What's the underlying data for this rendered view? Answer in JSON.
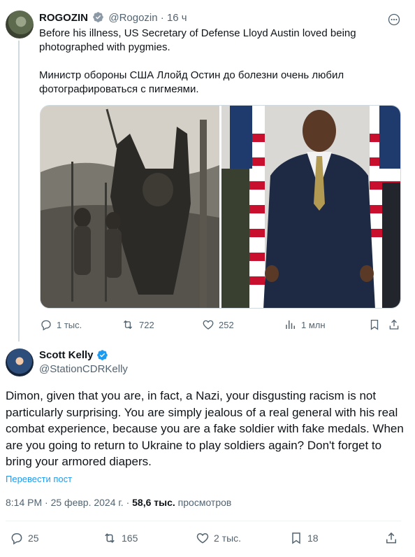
{
  "parent_tweet": {
    "author_name": "ROGOZIN",
    "author_handle": "@Rogozin",
    "separator": "·",
    "time": "16 ч",
    "text": "Before his illness, US Secretary of Defense Lloyd Austin loved being photographed with pygmies.\n\nМинистр обороны США Ллойд Остин до болезни очень любил фотографироваться с пигмеями.",
    "actions": {
      "replies": "1 тыс.",
      "reposts": "722",
      "likes": "252",
      "views": "1 млн"
    }
  },
  "reply_tweet": {
    "author_name": "Scott Kelly",
    "author_handle": "@StationCDRKelly",
    "text": "Dimon, given that you are, in fact, a Nazi, your disgusting racism is not particularly surprising. You are simply jealous of a real general with his real combat experience, because you are a fake soldier with fake medals. When are you going to return to Ukraine to play soldiers again? Don't forget to bring your armored diapers.",
    "translate_label": "Перевести пост",
    "time": "8:14 PM",
    "separator": "·",
    "date": "25 февр. 2024 г.",
    "views_count": "58,6 тыс.",
    "views_label": "просмотров",
    "actions": {
      "replies": "25",
      "reposts": "165",
      "likes": "2 тыс.",
      "bookmarks": "18"
    }
  },
  "colors": {
    "text": "#0f1419",
    "muted": "#536471",
    "link": "#1d9bf0",
    "verified": "#1d9bf0",
    "thread_line": "#cfd9de"
  },
  "icons": [
    "more-icon",
    "verified-badge-icon",
    "reply-icon",
    "repost-icon",
    "like-icon",
    "views-icon",
    "bookmark-icon",
    "share-icon"
  ]
}
